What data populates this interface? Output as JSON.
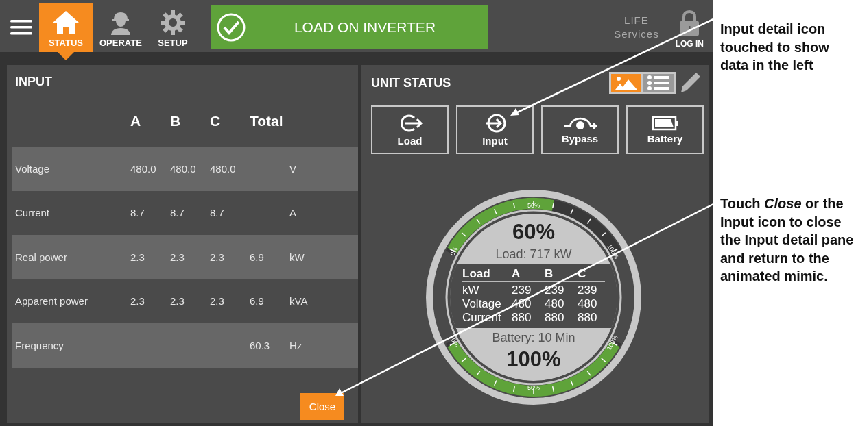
{
  "tabs": [
    {
      "label": "STATUS",
      "kind": "home",
      "selected": true
    },
    {
      "label": "OPERATE",
      "kind": "operate",
      "selected": false
    },
    {
      "label": "SETUP",
      "kind": "setup",
      "selected": false
    }
  ],
  "status_banner": {
    "text": "LOAD ON INVERTER"
  },
  "services": {
    "lines": [
      "LIFE",
      "Services"
    ]
  },
  "login": {
    "label": "LOG IN"
  },
  "input_panel": {
    "title": "INPUT",
    "columns": [
      "A",
      "B",
      "C",
      "Total"
    ],
    "rows": [
      {
        "label": "Voltage",
        "a": "480.0",
        "b": "480.0",
        "c": "480.0",
        "unit": "V"
      },
      {
        "label": "Current",
        "a": "8.7",
        "b": "8.7",
        "c": "8.7",
        "unit": "A"
      },
      {
        "label": "Real power",
        "a": "2.3",
        "b": "2.3",
        "c": "2.3",
        "total": "6.9",
        "unit": "kW"
      },
      {
        "label": "Apparent power",
        "a": "2.3",
        "b": "2.3",
        "c": "2.3",
        "total": "6.9",
        "unit": "kVA"
      },
      {
        "label": "Frequency",
        "total": "60.3",
        "unit": "Hz"
      }
    ],
    "close_button": "Close"
  },
  "unit_status": {
    "title": "UNIT STATUS",
    "view_toggle": [
      {
        "kind": "mimic",
        "selected": true
      },
      {
        "kind": "list",
        "selected": false
      }
    ],
    "buttons": [
      {
        "label": "Load",
        "kind": "load"
      },
      {
        "label": "Input",
        "kind": "input"
      },
      {
        "label": "Bypass",
        "kind": "bypass"
      },
      {
        "label": "Battery",
        "kind": "battery"
      }
    ],
    "gauge": {
      "load": {
        "percent": "60%",
        "label": "Load: 717 kW",
        "level": 0.6,
        "tick_labels": [
          "0%",
          "50%",
          "100%"
        ]
      },
      "battery": {
        "percent": "100%",
        "label": "Battery: 10 Min",
        "level": 1.0,
        "tick_labels": [
          "0%",
          "50%",
          "100%"
        ]
      },
      "table": {
        "columns": [
          "Load",
          "A",
          "B",
          "C"
        ],
        "rows": [
          [
            "kW",
            "239",
            "239",
            "239"
          ],
          [
            "Voltage",
            "480",
            "480",
            "480"
          ],
          [
            "Current",
            "880",
            "880",
            "880"
          ]
        ]
      }
    }
  },
  "annotations": [
    {
      "text": "Input detail icon touched to show data in the left"
    },
    {
      "text": "Touch *Close* or the Input icon to close the Input detail pane and return to the animated mimic."
    }
  ]
}
